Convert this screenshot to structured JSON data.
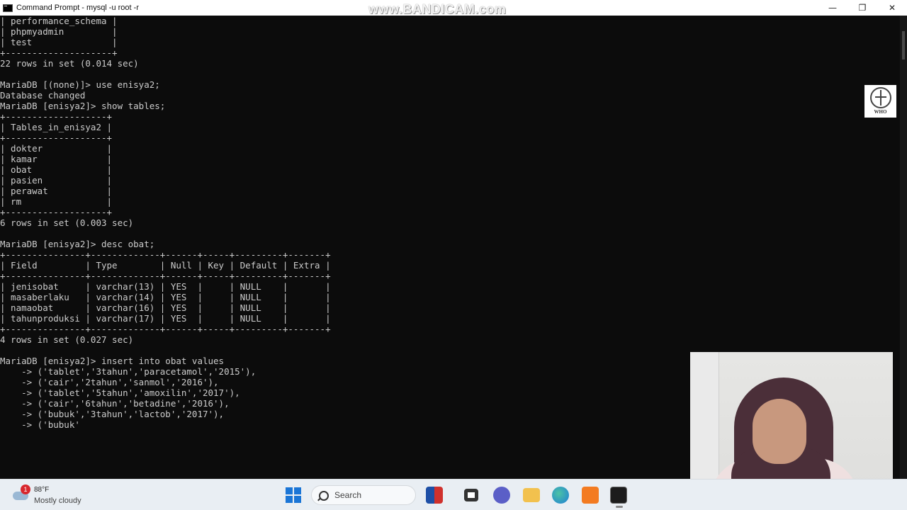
{
  "window": {
    "title": "Command Prompt - mysql  -u root -r",
    "watermark": "www.BANDICAM.com",
    "controls": {
      "minimize": "—",
      "maximize": "❐",
      "close": "✕"
    }
  },
  "terminal": {
    "text": "| performance_schema |\n| phpmyadmin         |\n| test               |\n+--------------------+\n22 rows in set (0.014 sec)\n\nMariaDB [(none)]> use enisya2;\nDatabase changed\nMariaDB [enisya2]> show tables;\n+-------------------+\n| Tables_in_enisya2 |\n+-------------------+\n| dokter            |\n| kamar             |\n| obat              |\n| pasien            |\n| perawat           |\n| rm                |\n+-------------------+\n6 rows in set (0.003 sec)\n\nMariaDB [enisya2]> desc obat;\n+---------------+-------------+------+-----+---------+-------+\n| Field         | Type        | Null | Key | Default | Extra |\n+---------------+-------------+------+-----+---------+-------+\n| jenisobat     | varchar(13) | YES  |     | NULL    |       |\n| masaberlaku   | varchar(14) | YES  |     | NULL    |       |\n| namaobat      | varchar(16) | YES  |     | NULL    |       |\n| tahunproduksi | varchar(17) | YES  |     | NULL    |       |\n+---------------+-------------+------+-----+---------+-------+\n4 rows in set (0.027 sec)\n\nMariaDB [enisya2]> insert into obat values\n    -> ('tablet','3tahun','paracetamol','2015'),\n    -> ('cair','2tahun','sanmol','2016'),\n    -> ('tablet','5tahun','amoxilin','2017'),\n    -> ('cair','6tahun','betadine','2016'),\n    -> ('bubuk','3tahun','lactob','2017'),\n    -> ('bubuk'"
  },
  "overlay_logo": {
    "label": "WHO",
    "icon": "who-emblem-icon"
  },
  "webcam": {
    "description_icon": "webcam-feed"
  },
  "taskbar": {
    "weather": {
      "badge": "1",
      "temp": "88°F",
      "condition": "Mostly cloudy",
      "icon": "cloud-icon"
    },
    "search_label": "Search",
    "apps": [
      {
        "name": "start-button",
        "icon": "windows-icon"
      },
      {
        "name": "flag-app",
        "icon": "flag-icon",
        "color": "#d0312d"
      },
      {
        "name": "task-view",
        "icon": "task-view-icon",
        "color": "#333333"
      },
      {
        "name": "teams-chat",
        "icon": "chat-icon",
        "color": "#5b5fc7"
      },
      {
        "name": "file-explorer",
        "icon": "folder-icon",
        "color": "#f2c14e"
      },
      {
        "name": "edge-browser",
        "icon": "edge-icon",
        "color": "#1f9ad6"
      },
      {
        "name": "xampp",
        "icon": "xampp-icon",
        "color": "#f37b21"
      },
      {
        "name": "command-prompt",
        "icon": "terminal-icon",
        "color": "#1c1c1c"
      }
    ]
  }
}
